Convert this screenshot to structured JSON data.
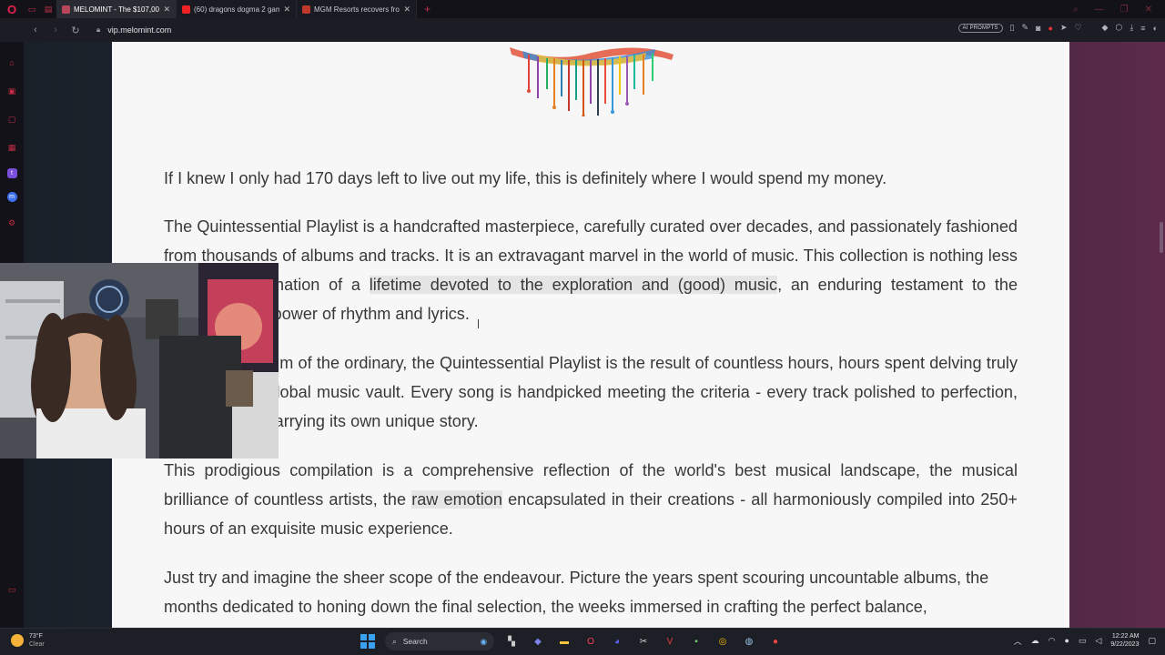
{
  "browser": {
    "tabs": [
      {
        "title": "MELOMINT - The $107,000",
        "active": true,
        "fav_color": "#b8465a"
      },
      {
        "title": "(60) dragons dogma 2 gam",
        "active": false,
        "fav_color": "#e22"
      },
      {
        "title": "MGM Resorts recovers fro",
        "active": false,
        "fav_color": "#c0392b"
      }
    ],
    "url": "vip.melomint.com",
    "ai_prompts_label": "AI PROMPTS"
  },
  "article": {
    "p1": "If I knew I only had 170 days left to live out my life, this is definitely where I would spend my money.",
    "p2_a": "The Quintessential Playlist is a handcrafted masterpiece, carefully curated over decades, and passionately fashioned from thousands of albums and tracks. It is an extravagant marvel in the world of music. This ",
    "p2_b": "collection is nothing less than the culmination of a ",
    "p2_hl": "lifetime devoted to the exploration and (good) music",
    "p2_c": ", an enduring testament to the transformative power of rhythm and lyrics.",
    "p3": "Beyond the realm of the ordinary, the Quintessential Playlist is the result of countless hours, hours spent delving truly deep into the global music vault. Every song is handpicked meeting the criteria - every track polished to perfection, every melody carrying its own unique story.",
    "p4_a": "This prodigious compilation is a comprehensive reflection of the world's best musical landscape, the musical brilliance of countless artists, the ",
    "p4_hl": "raw emotion",
    "p4_b": " encapsulated in their creations - all harmoniously compiled into 250+ hours of an exquisite music experience.",
    "p5": "Just try and imagine the sheer scope of the endeavour. Picture the years spent scouring uncountable albums, the months dedicated to honing down the final selection, the weeks immersed in crafting the perfect balance,"
  },
  "taskbar": {
    "weather_temp": "73°F",
    "weather_cond": "Clear",
    "search_label": "Search",
    "time": "12:22 AM",
    "date": "9/22/2023"
  }
}
